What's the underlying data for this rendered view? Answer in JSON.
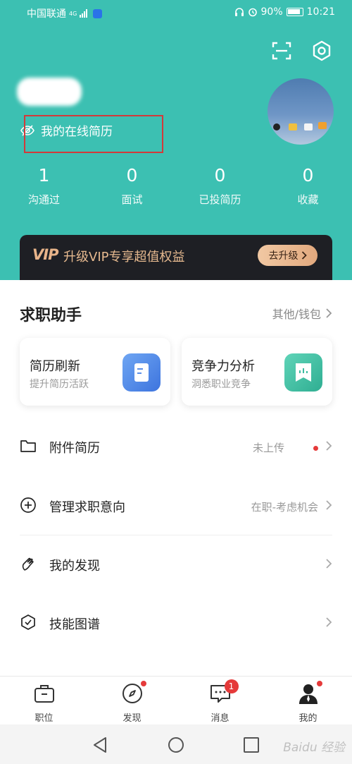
{
  "status_bar": {
    "carrier": "中国联通",
    "network": "4G",
    "battery": "90%",
    "time": "10:21"
  },
  "header": {
    "online_resume": "我的在线简历",
    "stats": [
      {
        "value": "1",
        "label": "沟通过"
      },
      {
        "value": "0",
        "label": "面试"
      },
      {
        "value": "0",
        "label": "已投简历"
      },
      {
        "value": "0",
        "label": "收藏"
      }
    ]
  },
  "vip": {
    "logo": "VIP",
    "text": "升级VIP专享超值权益",
    "button": "去升级"
  },
  "assistant": {
    "title": "求职助手",
    "more": "其他/钱包",
    "cards": [
      {
        "title": "简历刷新",
        "subtitle": "提升简历活跃"
      },
      {
        "title": "竞争力分析",
        "subtitle": "洞悉职业竞争"
      }
    ]
  },
  "menu": {
    "items": [
      {
        "label": "附件简历",
        "value": "未上传"
      },
      {
        "label": "管理求职意向",
        "value": "在职-考虑机会"
      },
      {
        "label": "我的发现",
        "value": ""
      },
      {
        "label": "技能图谱",
        "value": ""
      }
    ]
  },
  "tabbar": {
    "tabs": [
      {
        "label": "职位"
      },
      {
        "label": "发现"
      },
      {
        "label": "消息",
        "badge": "1"
      },
      {
        "label": "我的"
      }
    ]
  },
  "watermark": "Baidu 经验",
  "colors": {
    "header_bg": "#3cc0b2",
    "highlight_box": "#d23a3a",
    "vip_bg": "#1e1f24",
    "vip_gold": "#e6b98f",
    "badge_red": "#e53a3a"
  }
}
